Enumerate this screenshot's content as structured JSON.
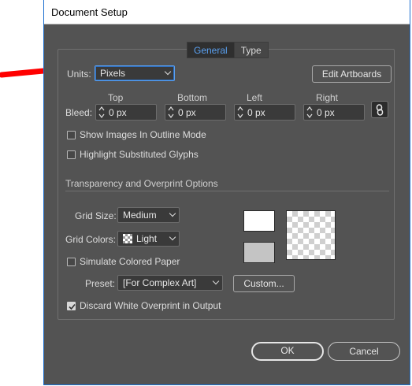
{
  "window": {
    "title": "Document Setup"
  },
  "tabs": [
    {
      "label": "General",
      "active": true
    },
    {
      "label": "Type",
      "active": false
    }
  ],
  "units": {
    "label": "Units:",
    "value": "Pixels"
  },
  "edit_artboards_label": "Edit Artboards",
  "bleed": {
    "label": "Bleed:",
    "top": {
      "heading": "Top",
      "value": "0 px"
    },
    "bottom": {
      "heading": "Bottom",
      "value": "0 px"
    },
    "left": {
      "heading": "Left",
      "value": "0 px"
    },
    "right": {
      "heading": "Right",
      "value": "0 px"
    }
  },
  "options": {
    "show_images_outline": {
      "label": "Show Images In Outline Mode",
      "checked": false
    },
    "highlight_glyphs": {
      "label": "Highlight Substituted Glyphs",
      "checked": false
    }
  },
  "transparency": {
    "section_title": "Transparency and Overprint Options",
    "grid_size": {
      "label": "Grid Size:",
      "value": "Medium"
    },
    "grid_colors": {
      "label": "Grid Colors:",
      "value": "Light"
    },
    "simulate_paper": {
      "label": "Simulate Colored Paper",
      "checked": false
    },
    "preset": {
      "label": "Preset:",
      "value": "[For Complex Art]"
    },
    "custom_label": "Custom...",
    "discard_white": {
      "label": "Discard White Overprint in Output",
      "checked": true
    }
  },
  "footer": {
    "ok_label": "OK",
    "cancel_label": "Cancel"
  },
  "colors": {
    "dialog_bg": "#535353",
    "accent": "#5aa0f0",
    "annotation_arrow": "#ff0000"
  }
}
